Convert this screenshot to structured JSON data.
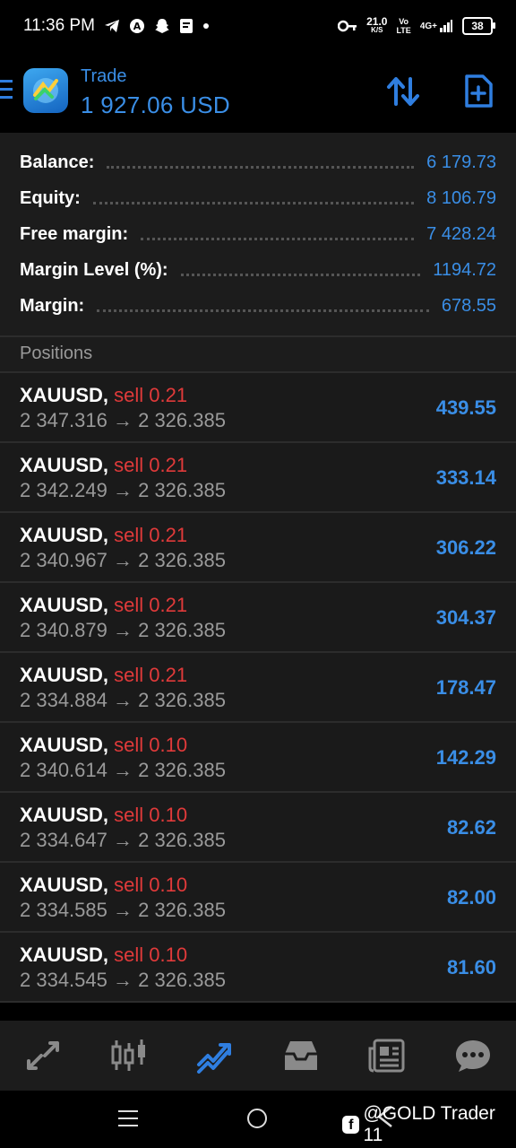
{
  "status_bar": {
    "time": "11:36 PM",
    "net_speed_value": "21.0",
    "net_speed_unit": "K/S",
    "volte_top": "Vo",
    "volte_bottom": "LTE",
    "network": "4G+",
    "battery": "38",
    "icons": [
      "telegram-icon",
      "adblock-icon",
      "snapchat-icon",
      "pdf-icon",
      "dot-icon",
      "key-icon",
      "signal-icon"
    ]
  },
  "header": {
    "title": "Trade",
    "value": "1 927.06 USD",
    "accent_color": "#3a8ee6",
    "icons": [
      "menu-icon",
      "metatrader-logo",
      "sort-icon",
      "new-order-icon"
    ]
  },
  "summary": [
    {
      "label": "Balance:",
      "value": "6 179.73"
    },
    {
      "label": "Equity:",
      "value": "8 106.79"
    },
    {
      "label": "Free margin:",
      "value": "7 428.24"
    },
    {
      "label": "Margin Level (%):",
      "value": "1194.72"
    },
    {
      "label": "Margin:",
      "value": "678.55"
    }
  ],
  "positions_title": "Positions",
  "positions": [
    {
      "symbol": "XAUUSD,",
      "side": "sell 0.21",
      "prices": "2 347.316 → 2 326.385",
      "profit": "439.55"
    },
    {
      "symbol": "XAUUSD,",
      "side": "sell 0.21",
      "prices": "2 342.249 → 2 326.385",
      "profit": "333.14"
    },
    {
      "symbol": "XAUUSD,",
      "side": "sell 0.21",
      "prices": "2 340.967 → 2 326.385",
      "profit": "306.22"
    },
    {
      "symbol": "XAUUSD,",
      "side": "sell 0.21",
      "prices": "2 340.879 → 2 326.385",
      "profit": "304.37"
    },
    {
      "symbol": "XAUUSD,",
      "side": "sell 0.21",
      "prices": "2 334.884 → 2 326.385",
      "profit": "178.47"
    },
    {
      "symbol": "XAUUSD,",
      "side": "sell 0.10",
      "prices": "2 340.614 → 2 326.385",
      "profit": "142.29"
    },
    {
      "symbol": "XAUUSD,",
      "side": "sell 0.10",
      "prices": "2 334.647 → 2 326.385",
      "profit": "82.62"
    },
    {
      "symbol": "XAUUSD,",
      "side": "sell 0.10",
      "prices": "2 334.585 → 2 326.385",
      "profit": "82.00"
    },
    {
      "symbol": "XAUUSD,",
      "side": "sell 0.10",
      "prices": "2 334.545 → 2 326.385",
      "profit": "81.60"
    }
  ],
  "bottom_nav": [
    {
      "name": "quotes-icon",
      "active": false
    },
    {
      "name": "chart-icon",
      "active": false
    },
    {
      "name": "trade-icon",
      "active": true
    },
    {
      "name": "history-icon",
      "active": false
    },
    {
      "name": "news-icon",
      "active": false
    },
    {
      "name": "messages-icon",
      "active": false
    }
  ],
  "watermark": "@GOLD Trader 11",
  "colors": {
    "profit": "#3a8ee6",
    "sell": "#e03a3a",
    "muted": "#9a9a9a"
  }
}
